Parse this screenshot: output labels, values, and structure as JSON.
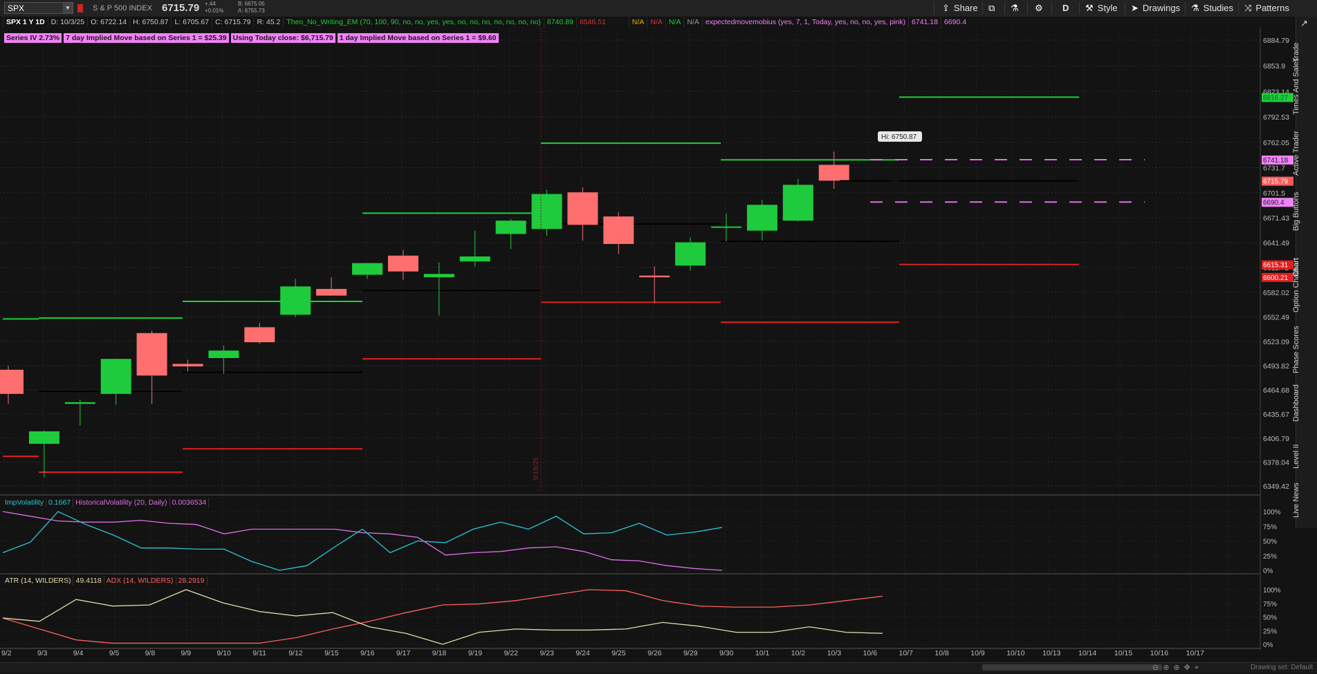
{
  "toolbar": {
    "symbol": "SPX",
    "description": "S & P 500 INDEX",
    "last": "6715.79",
    "change_line1": "+.44",
    "change_line2": "+0.01%",
    "bid": "B: 6675.05",
    "ask": "A: 6755.73",
    "buttons": [
      "Share",
      "D",
      "Style",
      "Drawings",
      "Studies",
      "Patterns"
    ]
  },
  "header": {
    "chart_label": "SPX 1 Y 1D",
    "date": "D: 10/3/25",
    "open": "O: 6722.14",
    "high": "H: 6750.87",
    "low": "L: 6705.67",
    "close": "C: 6715.79",
    "range": "R: 45.2",
    "study1": "Theo_No_Writing_EM (70, 100, 90, no, no, yes, yes, no, no, no, no, no, no, no)",
    "study1_v1": "6740.89",
    "study1_v2": "6546.51",
    "na1": "N/A",
    "na2": "N/A",
    "na3": "N/A",
    "na4": "N/A",
    "study2": "expectedmovemobius (yes, 7, 1, Today, yes, no, no, yes, pink)",
    "study2_v1": "6741.18",
    "study2_v2": "6690.4"
  },
  "labels": {
    "series_iv": "Series IV 2.73%",
    "seven_day": "7 day Implied Move based on Series 1 = $25.39",
    "today_close": "Using Today close: $6,715.79",
    "one_day": "1 day Implied Move based on Series 1 = $9.60"
  },
  "hi_bubble": "Hi: 6750.87",
  "expiry_marker": "9/19/25",
  "price_axis": [
    "6884.79",
    "6853.9",
    "6823.14",
    "6792.53",
    "6762.05",
    "6731.7",
    "6701.5",
    "6671.43",
    "6641.49",
    "6611.72",
    "6582.02",
    "6552.49",
    "6523.09",
    "6493.82",
    "6464.68",
    "6435.67",
    "6406.79",
    "6378.04",
    "6349.42"
  ],
  "price_badges": [
    {
      "text": "6816.27",
      "color": "#1fcf3a",
      "price": 6816.27
    },
    {
      "text": "6741.18",
      "color": "#f281f8",
      "price": 6741.18
    },
    {
      "text": "6715.79",
      "color": "#ff5a5a",
      "price": 6715.79
    },
    {
      "text": "6690.4",
      "color": "#f281f8",
      "price": 6690.4
    },
    {
      "text": "6615.31",
      "color": "#e02020",
      "price": 6615.31
    },
    {
      "text": "6600.21",
      "color": "#e02020",
      "price": 6600.21
    }
  ],
  "sidebar_tabs": [
    "Trade",
    "Times And Sales",
    "Active Trader",
    "Big Buttons",
    "Chart",
    "Option Chain",
    "Phase Scores",
    "Dashboard",
    "Level II",
    "Live News"
  ],
  "dates": [
    "9/2",
    "9/3",
    "9/4",
    "9/5",
    "9/8",
    "9/9",
    "9/10",
    "9/11",
    "9/12",
    "9/15",
    "9/16",
    "9/17",
    "9/18",
    "9/19",
    "9/22",
    "9/23",
    "9/24",
    "9/25",
    "9/26",
    "9/29",
    "9/30",
    "10/1",
    "10/2",
    "10/3",
    "10/6",
    "10/7",
    "10/8",
    "10/9",
    "10/10",
    "10/13",
    "10/14",
    "10/15",
    "10/16",
    "10/17"
  ],
  "vol_study": {
    "name1": "ImpVolatility",
    "value1": "0.1667",
    "name2": "HistoricalVolatility (20, Daily)",
    "value2": "0.0036534",
    "axis": [
      "100%",
      "75%",
      "50%",
      "25%",
      "0%"
    ]
  },
  "atr_study": {
    "name1": "ATR (14, WILDERS)",
    "value1": "49.4118",
    "name2": "ADX (14, WILDERS)",
    "value2": "28.2919",
    "axis": [
      "100%",
      "75%",
      "50%",
      "25%",
      "0%"
    ]
  },
  "footer": {
    "drawing_set": "Drawing set: Default"
  },
  "colors": {
    "up": "#1ecb3c",
    "down": "#ff6f6f",
    "green_line": "#1fcf3a",
    "red_line": "#e02020",
    "pink": "#e070e8",
    "cyan": "#2ac8d8",
    "tan": "#e6dca8",
    "salmon": "#ff6060"
  },
  "chart_data": {
    "type": "candlestick",
    "candles": [
      {
        "d": "9/2",
        "o": 6489,
        "h": 6494,
        "l": 6448,
        "c": 6460
      },
      {
        "d": "9/3",
        "o": 6400,
        "h": 6416,
        "l": 6360,
        "c": 6415
      },
      {
        "d": "9/4",
        "o": 6448,
        "h": 6453,
        "l": 6422,
        "c": 6450
      },
      {
        "d": "9/5",
        "o": 6460,
        "h": 6502,
        "l": 6447,
        "c": 6502
      },
      {
        "d": "9/8",
        "o": 6533,
        "h": 6536,
        "l": 6448,
        "c": 6482
      },
      {
        "d": "9/9",
        "o": 6496,
        "h": 6501,
        "l": 6487,
        "c": 6493
      },
      {
        "d": "9/10",
        "o": 6503,
        "h": 6518,
        "l": 6484,
        "c": 6512
      },
      {
        "d": "9/11",
        "o": 6540,
        "h": 6545,
        "l": 6520,
        "c": 6522
      },
      {
        "d": "9/12",
        "o": 6555,
        "h": 6598,
        "l": 6552,
        "c": 6589
      },
      {
        "d": "9/15",
        "o": 6586,
        "h": 6600,
        "l": 6578,
        "c": 6578
      },
      {
        "d": "9/16",
        "o": 6603,
        "h": 6607,
        "l": 6598,
        "c": 6617
      },
      {
        "d": "9/17",
        "o": 6626,
        "h": 6633,
        "l": 6597,
        "c": 6607
      },
      {
        "d": "9/18",
        "o": 6600,
        "h": 6618,
        "l": 6554,
        "c": 6604
      },
      {
        "d": "9/19",
        "o": 6619,
        "h": 6656,
        "l": 6613,
        "c": 6625
      },
      {
        "d": "9/22",
        "o": 6652,
        "h": 6670,
        "l": 6634,
        "c": 6668
      },
      {
        "d": "9/23",
        "o": 6658,
        "h": 6705,
        "l": 6650,
        "c": 6700
      },
      {
        "d": "9/24",
        "o": 6702,
        "h": 6708,
        "l": 6644,
        "c": 6663
      },
      {
        "d": "9/25",
        "o": 6673,
        "h": 6678,
        "l": 6628,
        "c": 6640
      },
      {
        "d": "9/26",
        "o": 6602,
        "h": 6613,
        "l": 6569,
        "c": 6600
      },
      {
        "d": "9/29",
        "o": 6614,
        "h": 6648,
        "l": 6608,
        "c": 6642
      },
      {
        "d": "9/30",
        "o": 6660,
        "h": 6677,
        "l": 6643,
        "c": 6661
      },
      {
        "d": "10/1",
        "o": 6656,
        "h": 6693,
        "l": 6644,
        "c": 6687
      },
      {
        "d": "10/2",
        "o": 6668,
        "h": 6718,
        "l": 6667,
        "c": 6711
      },
      {
        "d": "10/3",
        "o": 6735,
        "h": 6751,
        "l": 6706,
        "c": 6716
      }
    ],
    "price_range": [
      6340,
      6895
    ]
  }
}
